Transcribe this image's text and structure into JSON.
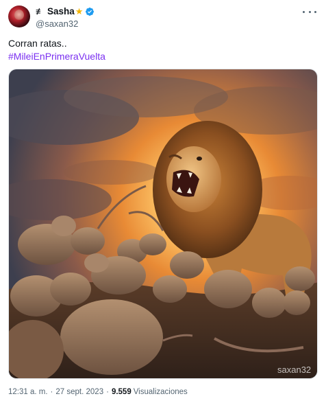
{
  "author": {
    "name_prefix": "≢",
    "display_name": "Sasha",
    "star": "★",
    "handle": "@saxan32",
    "avatar_icon": "avatar-portrait",
    "verified_icon": "verified-badge-icon",
    "verified_color": "#1d9bf0"
  },
  "tweet": {
    "text": "Corran ratas..",
    "hashtag": "#MileiEnPrimeraVuelta",
    "hashtag_color": "#7a2ff0"
  },
  "media": {
    "description_icon": "ai-image-lion-roaring-at-rats",
    "watermark": "saxan32"
  },
  "meta": {
    "time": "12:31 a. m.",
    "separator": "·",
    "date": "27 sept. 2023",
    "views_count": "9.559",
    "views_label": "Visualizaciones"
  }
}
